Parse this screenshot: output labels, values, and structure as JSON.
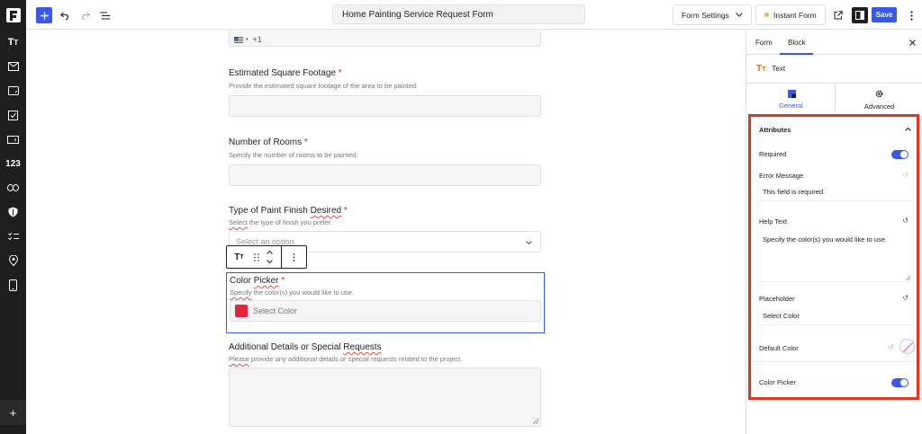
{
  "toolbar": {
    "form_title": "Home Painting Service Request Form",
    "form_settings": "Form Settings",
    "instant_form": "Instant Form",
    "save": "Save"
  },
  "sidebar": {
    "icons": [
      "text-icon",
      "mail-icon",
      "textarea-icon",
      "checkbox-icon",
      "input-icon",
      "number-icon",
      "link-icon",
      "shield-icon",
      "list-check-icon",
      "location-pin-icon",
      "mobile-icon"
    ],
    "number_label": "123"
  },
  "form": {
    "phone": {
      "country_flag": "US",
      "dial_code": "+1"
    },
    "sq_footage": {
      "label": "Estimated Square Footage",
      "required_mark": "*",
      "help": "Provide the estimated square footage of the area to be painted."
    },
    "rooms": {
      "label": "Number of Rooms",
      "required_mark": "*",
      "help": "Specify the number of rooms to be painted."
    },
    "paint_finish": {
      "label_part1": "Type of Paint Finish ",
      "label_part2": "Desired",
      "required_mark": "*",
      "help_part1": "Select",
      "help_part2": " the type of finish you prefer.",
      "placeholder": "Select an option"
    },
    "color_picker": {
      "label_part1": "Color ",
      "label_part2": "Picker",
      "required_mark": "*",
      "help_part1": "Specify",
      "help_part2": " the color(s) you would like to use.",
      "placeholder": "Select Color",
      "swatch_color": "#e5243b"
    },
    "details": {
      "label_part1": "Additional Details or Special ",
      "label_part2": "Requests",
      "help_part1": "Please",
      "help_part2": " provide any additional details or special requests related to the project."
    }
  },
  "block_toolbar": {
    "type_icon": "text-icon"
  },
  "panel": {
    "tabs": [
      "Form",
      "Block"
    ],
    "active_tab": "Block",
    "block_type": "Text",
    "subtabs": [
      "General",
      "Advanced"
    ],
    "attributes_title": "Attributes",
    "required_label": "Required",
    "required_on": true,
    "error_message_label": "Error Message",
    "error_message_value": "This field is required.",
    "help_text_label": "Help Text",
    "help_text_value": "Specify the color(s) you would like to use.",
    "placeholder_label": "Placeholder",
    "placeholder_value": "Select Color",
    "default_color_label": "Default Color",
    "color_picker_label": "Color Picker",
    "color_picker_on": true
  },
  "colors": {
    "accent": "#3858e9",
    "highlight_border": "#e8341c",
    "sidebar_bg": "#1e1e1e"
  }
}
